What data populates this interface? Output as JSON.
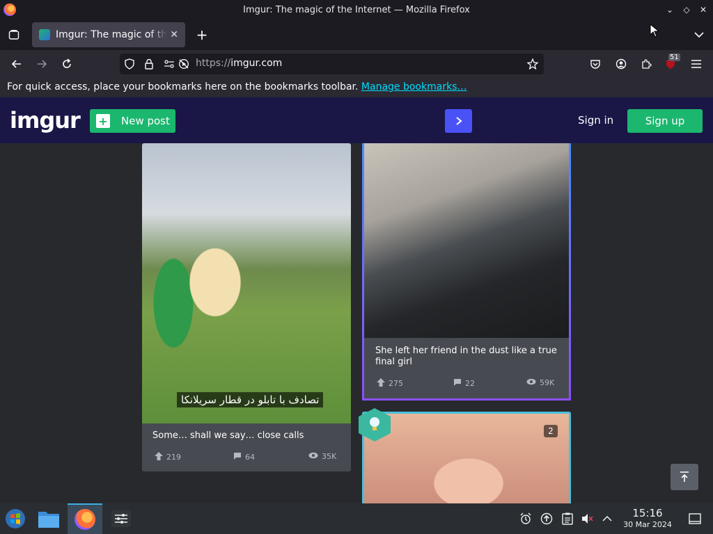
{
  "window": {
    "title": "Imgur: The magic of the Internet — Mozilla Firefox"
  },
  "tab": {
    "label": "Imgur: The magic of the Internet",
    "close": "✕",
    "new_tab": "+"
  },
  "navbar": {
    "url_protocol": "https://",
    "url_host": "imgur.com",
    "extension_badge": "51"
  },
  "bookmarks_bar": {
    "message": "For quick access, place your bookmarks here on the bookmarks toolbar. ",
    "link": "Manage bookmarks…"
  },
  "imgur": {
    "logo": "imgur",
    "new_post": "New post",
    "sign_in": "Sign in",
    "sign_up": "Sign up"
  },
  "posts": [
    {
      "overlay_text": "تصادف با تابلو در قطار سریلانکا",
      "caption": "Some… shall we say… close calls",
      "upvotes": "219",
      "comments": "64",
      "views": "35K"
    },
    {
      "caption": "She left her friend in the dust like a true final girl",
      "upvotes": "275",
      "comments": "22",
      "views": "59K"
    },
    {
      "count_badge": "2"
    }
  ],
  "taskbar": {
    "time": "15:16",
    "date": "30 Mar 2024"
  }
}
